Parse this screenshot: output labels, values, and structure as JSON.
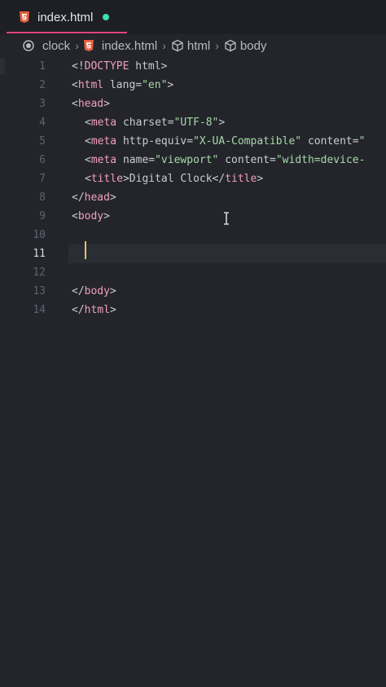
{
  "tab": {
    "label": "index.html",
    "icon": "html5-icon",
    "modified_dot_color": "#3ce0b3",
    "accent_color": "#e0457c"
  },
  "breadcrumb": {
    "items": [
      {
        "label": "clock",
        "icon": "target-icon"
      },
      {
        "label": "index.html",
        "icon": "html5-icon"
      },
      {
        "label": "html",
        "icon": "cube-icon"
      },
      {
        "label": "body",
        "icon": "cube-icon"
      }
    ]
  },
  "editor": {
    "active_line": 11,
    "lines": [
      {
        "n": "1",
        "parts": [
          {
            "t": "punct",
            "v": "<!"
          },
          {
            "t": "tag",
            "v": "DOCTYPE"
          },
          {
            "t": "attr",
            "v": " html"
          },
          {
            "t": "punct",
            "v": ">"
          }
        ]
      },
      {
        "n": "2",
        "parts": [
          {
            "t": "punct",
            "v": "<"
          },
          {
            "t": "tag",
            "v": "html"
          },
          {
            "t": "attr",
            "v": " lang"
          },
          {
            "t": "punct",
            "v": "="
          },
          {
            "t": "str",
            "v": "\"en\""
          },
          {
            "t": "punct",
            "v": ">"
          }
        ]
      },
      {
        "n": "3",
        "parts": [
          {
            "t": "punct",
            "v": "<"
          },
          {
            "t": "tag",
            "v": "head"
          },
          {
            "t": "punct",
            "v": ">"
          }
        ]
      },
      {
        "n": "4",
        "indent": true,
        "parts": [
          {
            "t": "punct",
            "v": "<"
          },
          {
            "t": "tag",
            "v": "meta"
          },
          {
            "t": "attr",
            "v": " charset"
          },
          {
            "t": "punct",
            "v": "="
          },
          {
            "t": "str",
            "v": "\"UTF-8\""
          },
          {
            "t": "punct",
            "v": ">"
          }
        ]
      },
      {
        "n": "5",
        "indent": true,
        "parts": [
          {
            "t": "punct",
            "v": "<"
          },
          {
            "t": "tag",
            "v": "meta"
          },
          {
            "t": "attr",
            "v": " http-equiv"
          },
          {
            "t": "punct",
            "v": "="
          },
          {
            "t": "str",
            "v": "\"X-UA-Compatible\""
          },
          {
            "t": "attr",
            "v": " content"
          },
          {
            "t": "punct",
            "v": "="
          },
          {
            "t": "str",
            "v": "\""
          }
        ]
      },
      {
        "n": "6",
        "indent": true,
        "parts": [
          {
            "t": "punct",
            "v": "<"
          },
          {
            "t": "tag",
            "v": "meta"
          },
          {
            "t": "attr",
            "v": " name"
          },
          {
            "t": "punct",
            "v": "="
          },
          {
            "t": "str",
            "v": "\"viewport\""
          },
          {
            "t": "attr",
            "v": " content"
          },
          {
            "t": "punct",
            "v": "="
          },
          {
            "t": "str",
            "v": "\"width=device-"
          }
        ]
      },
      {
        "n": "7",
        "indent": true,
        "parts": [
          {
            "t": "punct",
            "v": "<"
          },
          {
            "t": "tag",
            "v": "title"
          },
          {
            "t": "punct",
            "v": ">"
          },
          {
            "t": "attr",
            "v": "Digital Clock"
          },
          {
            "t": "punct",
            "v": "</"
          },
          {
            "t": "tag",
            "v": "title"
          },
          {
            "t": "punct",
            "v": ">"
          }
        ]
      },
      {
        "n": "8",
        "parts": [
          {
            "t": "punct",
            "v": "</"
          },
          {
            "t": "tag",
            "v": "head"
          },
          {
            "t": "punct",
            "v": ">"
          }
        ]
      },
      {
        "n": "9",
        "parts": [
          {
            "t": "punct",
            "v": "<"
          },
          {
            "t": "tag",
            "v": "body"
          },
          {
            "t": "punct",
            "v": ">"
          }
        ]
      },
      {
        "n": "10",
        "parts": []
      },
      {
        "n": "11",
        "parts": []
      },
      {
        "n": "12",
        "parts": []
      },
      {
        "n": "13",
        "parts": [
          {
            "t": "punct",
            "v": "</"
          },
          {
            "t": "tag",
            "v": "body"
          },
          {
            "t": "punct",
            "v": ">"
          }
        ]
      },
      {
        "n": "14",
        "parts": [
          {
            "t": "punct",
            "v": "</"
          },
          {
            "t": "tag",
            "v": "html"
          },
          {
            "t": "punct",
            "v": ">"
          }
        ]
      }
    ]
  }
}
